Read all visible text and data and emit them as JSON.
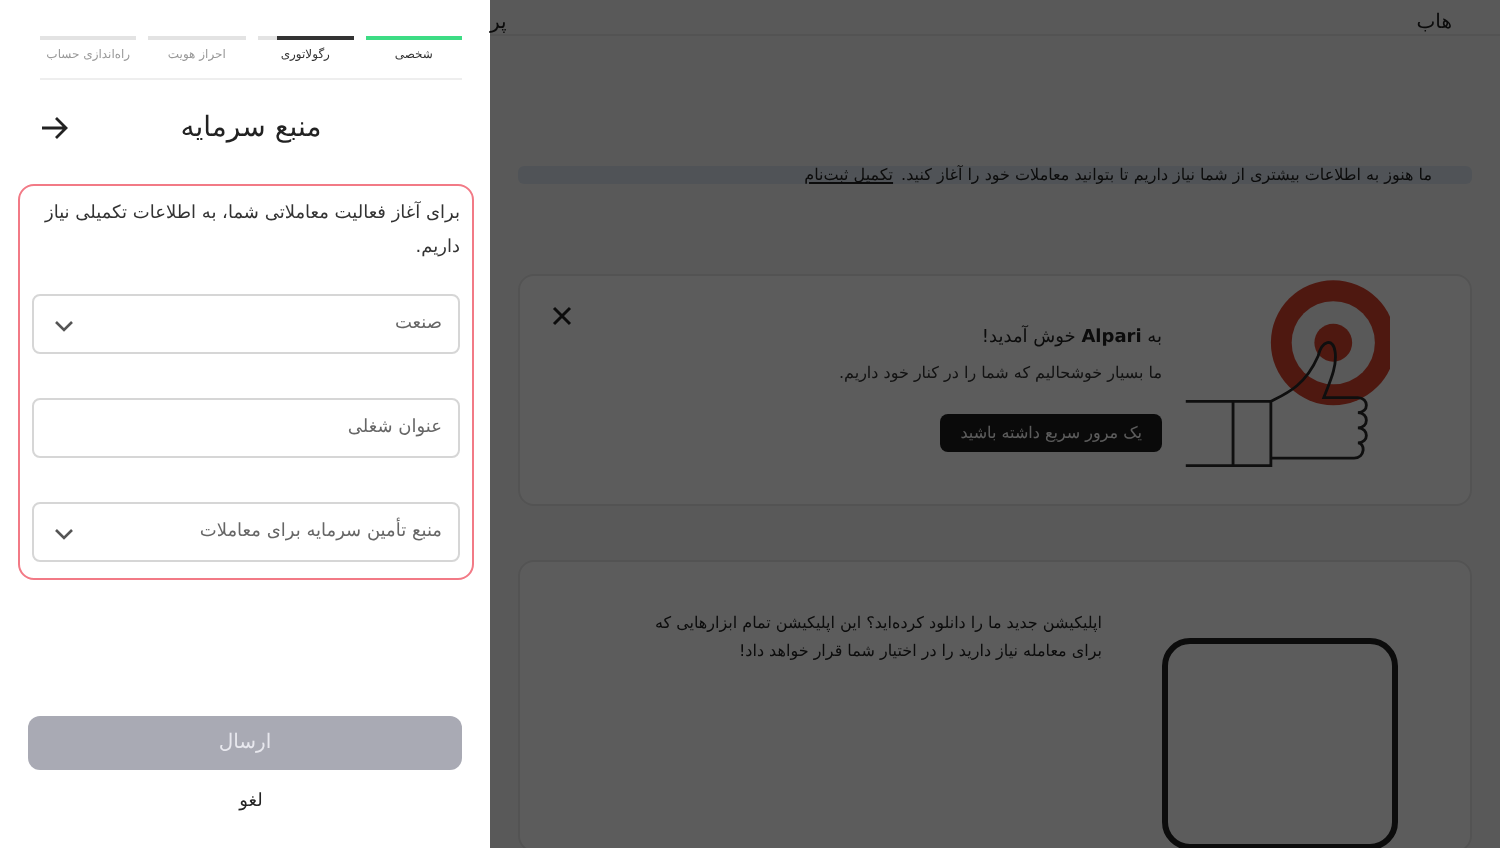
{
  "steps": [
    {
      "label": "شخصی",
      "completed": true,
      "selected": false
    },
    {
      "label": "رگولاتوری",
      "completed": false,
      "selected": true
    },
    {
      "label": "احراز هویت",
      "completed": false,
      "selected": false
    },
    {
      "label": "راه‌اندازی حساب",
      "completed": false,
      "selected": false
    }
  ],
  "form": {
    "title": "منبع سرمایه",
    "description": "برای آغاز فعالیت معاملاتی شما، به اطلاعات تکمیلی نیاز داریم.",
    "fields": [
      {
        "kind": "select",
        "placeholder": "صنعت"
      },
      {
        "kind": "input",
        "placeholder": "عنوان شغلی"
      },
      {
        "kind": "select",
        "placeholder": "منبع تأمین سرمایه برای معاملات"
      }
    ],
    "submit": {
      "label": "ارسال",
      "disabled": true
    },
    "cancel": "لغو"
  },
  "background": {
    "nav": [
      "هاب",
      "پر"
    ],
    "banner": {
      "text": "ما هنوز به اطلاعات بیشتری از شما نیاز داریم تا بتوانید معاملات خود را آغاز کنید.",
      "link": "تکمیل ثبت‌نام"
    },
    "welcome": {
      "title": "به **Alpari** خوش آمدید!",
      "text": "ما بسیار خوشحالیم که شما را در کنار خود داریم.",
      "button": "یک مرور سریع داشته باشید"
    },
    "app_card": {
      "text": "اپلیکیشن جدید ما را دانلود کرده‌اید؟ این اپلیکیشن تمام ابزارهایی که برای معامله نیاز دارید را در اختیار شما قرار خواهد داد!"
    }
  }
}
